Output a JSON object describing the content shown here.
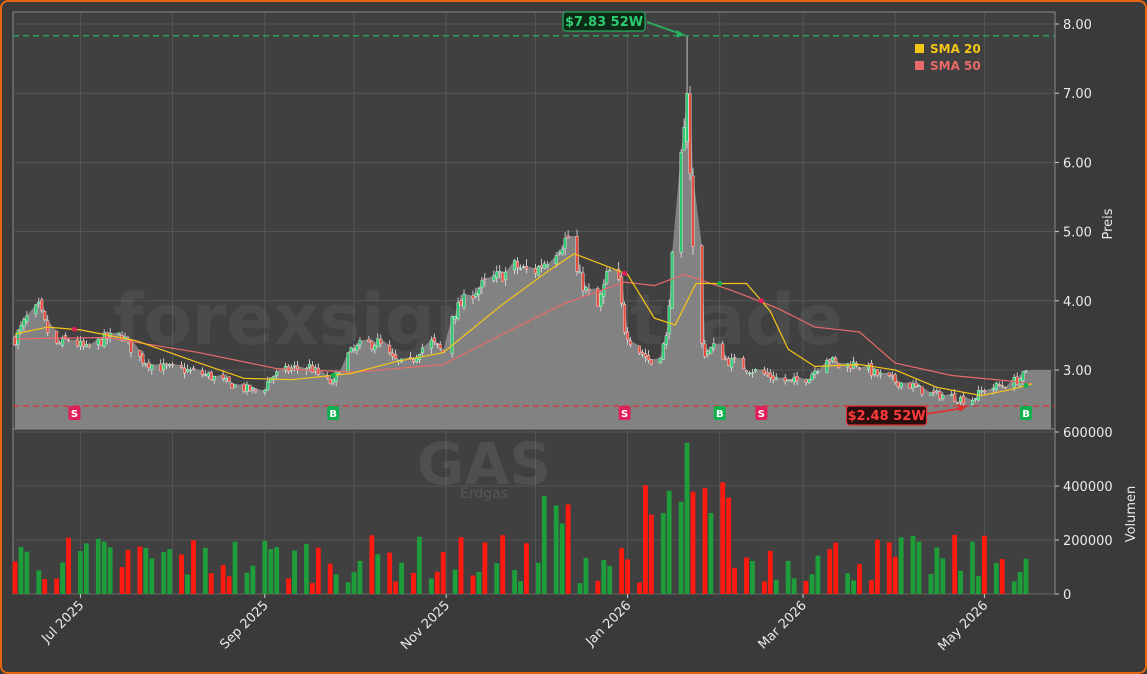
{
  "chart_data": {
    "type": "candlestick",
    "ticker": "GAS",
    "watermark": "forexsignale.trade",
    "watermark_sub": "Erdgas",
    "price_axis": {
      "label": "Preis",
      "ylim": [
        2.2,
        8.15
      ],
      "ticks": [
        "3.00",
        "4.00",
        "5.00",
        "6.00",
        "7.00",
        "8.00"
      ]
    },
    "volume_axis": {
      "label": "Volumen",
      "ylim": [
        0,
        650000
      ],
      "ticks": [
        "0",
        "200000",
        "400000",
        "600000"
      ]
    },
    "x_ticks": [
      "Jul 2025",
      "Sep 2025",
      "Nov 2025",
      "Jan 2026",
      "Mar 2026",
      "May 2026"
    ],
    "x_range": [
      "2025-06-09",
      "2026-05-17"
    ],
    "legend": {
      "position": "top-right",
      "items": [
        {
          "label": "SMA 20",
          "color": "#f5c518"
        },
        {
          "label": "SMA 50",
          "color": "#e86a6a"
        }
      ]
    },
    "high_52w": {
      "value": 7.83,
      "label": "$7.83 52W",
      "date": "2026-01-21",
      "color": "#27ae60"
    },
    "low_52w": {
      "value": 2.48,
      "label": "$2.48 52W",
      "date": "2026-04-26",
      "color": "#e03030"
    },
    "signals": [
      {
        "type": "S",
        "date": "2025-06-29"
      },
      {
        "type": "B",
        "date": "2025-09-24"
      },
      {
        "type": "S",
        "date": "2025-12-31"
      },
      {
        "type": "B",
        "date": "2026-02-01"
      },
      {
        "type": "S",
        "date": "2026-02-15"
      },
      {
        "type": "B",
        "date": "2026-05-15"
      }
    ],
    "price_path": [
      [
        "2025-06-09",
        3.45
      ],
      [
        "2025-06-13",
        3.75
      ],
      [
        "2025-06-17",
        3.9
      ],
      [
        "2025-06-20",
        3.55
      ],
      [
        "2025-06-23",
        3.35
      ],
      [
        "2025-06-27",
        3.45
      ],
      [
        "2025-07-03",
        3.3
      ],
      [
        "2025-07-09",
        3.45
      ],
      [
        "2025-07-15",
        3.5
      ],
      [
        "2025-07-20",
        3.2
      ],
      [
        "2025-07-26",
        3.05
      ],
      [
        "2025-08-05",
        3.0
      ],
      [
        "2025-08-13",
        2.92
      ],
      [
        "2025-08-20",
        2.8
      ],
      [
        "2025-08-26",
        2.72
      ],
      [
        "2025-08-31",
        2.68
      ],
      [
        "2025-09-03",
        2.9
      ],
      [
        "2025-09-10",
        3.02
      ],
      [
        "2025-09-16",
        3.05
      ],
      [
        "2025-09-21",
        2.85
      ],
      [
        "2025-09-24",
        2.8
      ],
      [
        "2025-09-27",
        3.15
      ],
      [
        "2025-10-03",
        3.35
      ],
      [
        "2025-10-09",
        3.4
      ],
      [
        "2025-10-14",
        3.15
      ],
      [
        "2025-10-19",
        3.05
      ],
      [
        "2025-10-23",
        3.3
      ],
      [
        "2025-10-27",
        3.4
      ],
      [
        "2025-10-31",
        3.25
      ],
      [
        "2025-11-03",
        3.8
      ],
      [
        "2025-11-09",
        4.1
      ],
      [
        "2025-11-16",
        4.3
      ],
      [
        "2025-11-21",
        4.4
      ],
      [
        "2025-11-24",
        4.5
      ],
      [
        "2025-11-30",
        4.4
      ],
      [
        "2025-12-05",
        4.6
      ],
      [
        "2025-12-09",
        4.8
      ],
      [
        "2025-12-13",
        4.95
      ],
      [
        "2025-12-15",
        4.4
      ],
      [
        "2025-12-18",
        4.15
      ],
      [
        "2025-12-22",
        3.9
      ],
      [
        "2025-12-25",
        4.35
      ],
      [
        "2025-12-28",
        4.55
      ],
      [
        "2025-12-31",
        3.6
      ],
      [
        "2026-01-03",
        3.35
      ],
      [
        "2026-01-07",
        3.2
      ],
      [
        "2026-01-10",
        3.05
      ],
      [
        "2026-01-14",
        3.45
      ],
      [
        "2026-01-16",
        4.6
      ],
      [
        "2026-01-18",
        5.6
      ],
      [
        "2026-01-20",
        6.4
      ],
      [
        "2026-01-21",
        7.45
      ],
      [
        "2026-01-22",
        5.9
      ],
      [
        "2026-01-24",
        3.6
      ],
      [
        "2026-01-27",
        3.25
      ],
      [
        "2026-01-31",
        3.35
      ],
      [
        "2026-02-03",
        3.15
      ],
      [
        "2026-02-09",
        3.05
      ],
      [
        "2026-02-15",
        2.95
      ],
      [
        "2026-02-20",
        2.88
      ],
      [
        "2026-02-25",
        2.82
      ],
      [
        "2026-03-01",
        2.85
      ],
      [
        "2026-03-05",
        3.0
      ],
      [
        "2026-03-09",
        3.2
      ],
      [
        "2026-03-13",
        3.05
      ],
      [
        "2026-03-19",
        3.1
      ],
      [
        "2026-03-25",
        2.95
      ],
      [
        "2026-03-31",
        2.85
      ],
      [
        "2026-04-06",
        2.78
      ],
      [
        "2026-04-13",
        2.65
      ],
      [
        "2026-04-20",
        2.62
      ],
      [
        "2026-04-26",
        2.55
      ],
      [
        "2026-05-01",
        2.72
      ],
      [
        "2026-05-07",
        2.78
      ],
      [
        "2026-05-12",
        2.85
      ],
      [
        "2026-05-17",
        3.0
      ]
    ],
    "sma20_path": [
      [
        "2025-06-09",
        3.52
      ],
      [
        "2025-06-20",
        3.62
      ],
      [
        "2025-07-01",
        3.58
      ],
      [
        "2025-07-20",
        3.42
      ],
      [
        "2025-08-10",
        3.1
      ],
      [
        "2025-08-25",
        2.88
      ],
      [
        "2025-09-10",
        2.86
      ],
      [
        "2025-09-30",
        2.95
      ],
      [
        "2025-10-15",
        3.12
      ],
      [
        "2025-10-31",
        3.25
      ],
      [
        "2025-11-10",
        3.6
      ],
      [
        "2025-11-20",
        3.95
      ],
      [
        "2025-12-05",
        4.42
      ],
      [
        "2025-12-14",
        4.68
      ],
      [
        "2025-12-25",
        4.5
      ],
      [
        "2026-01-01",
        4.38
      ],
      [
        "2026-01-10",
        3.75
      ],
      [
        "2026-01-17",
        3.65
      ],
      [
        "2026-01-24",
        4.25
      ],
      [
        "2026-02-01",
        4.25
      ],
      [
        "2026-02-10",
        4.25
      ],
      [
        "2026-02-18",
        3.85
      ],
      [
        "2026-02-24",
        3.3
      ],
      [
        "2026-03-05",
        3.05
      ],
      [
        "2026-03-20",
        3.08
      ],
      [
        "2026-04-01",
        3.0
      ],
      [
        "2026-04-15",
        2.75
      ],
      [
        "2026-04-30",
        2.63
      ],
      [
        "2026-05-10",
        2.72
      ],
      [
        "2026-05-17",
        2.8
      ]
    ],
    "sma50_path": [
      [
        "2025-06-09",
        3.45
      ],
      [
        "2025-07-10",
        3.47
      ],
      [
        "2025-08-10",
        3.25
      ],
      [
        "2025-09-05",
        3.02
      ],
      [
        "2025-10-01",
        2.97
      ],
      [
        "2025-10-31",
        3.08
      ],
      [
        "2025-11-20",
        3.52
      ],
      [
        "2025-12-10",
        3.95
      ],
      [
        "2025-12-31",
        4.27
      ],
      [
        "2026-01-10",
        4.22
      ],
      [
        "2026-01-20",
        4.38
      ],
      [
        "2026-02-05",
        4.15
      ],
      [
        "2026-02-20",
        3.9
      ],
      [
        "2026-03-05",
        3.62
      ],
      [
        "2026-03-20",
        3.55
      ],
      [
        "2026-04-01",
        3.1
      ],
      [
        "2026-04-20",
        2.92
      ],
      [
        "2026-05-10",
        2.84
      ],
      [
        "2026-05-17",
        2.8
      ]
    ]
  }
}
